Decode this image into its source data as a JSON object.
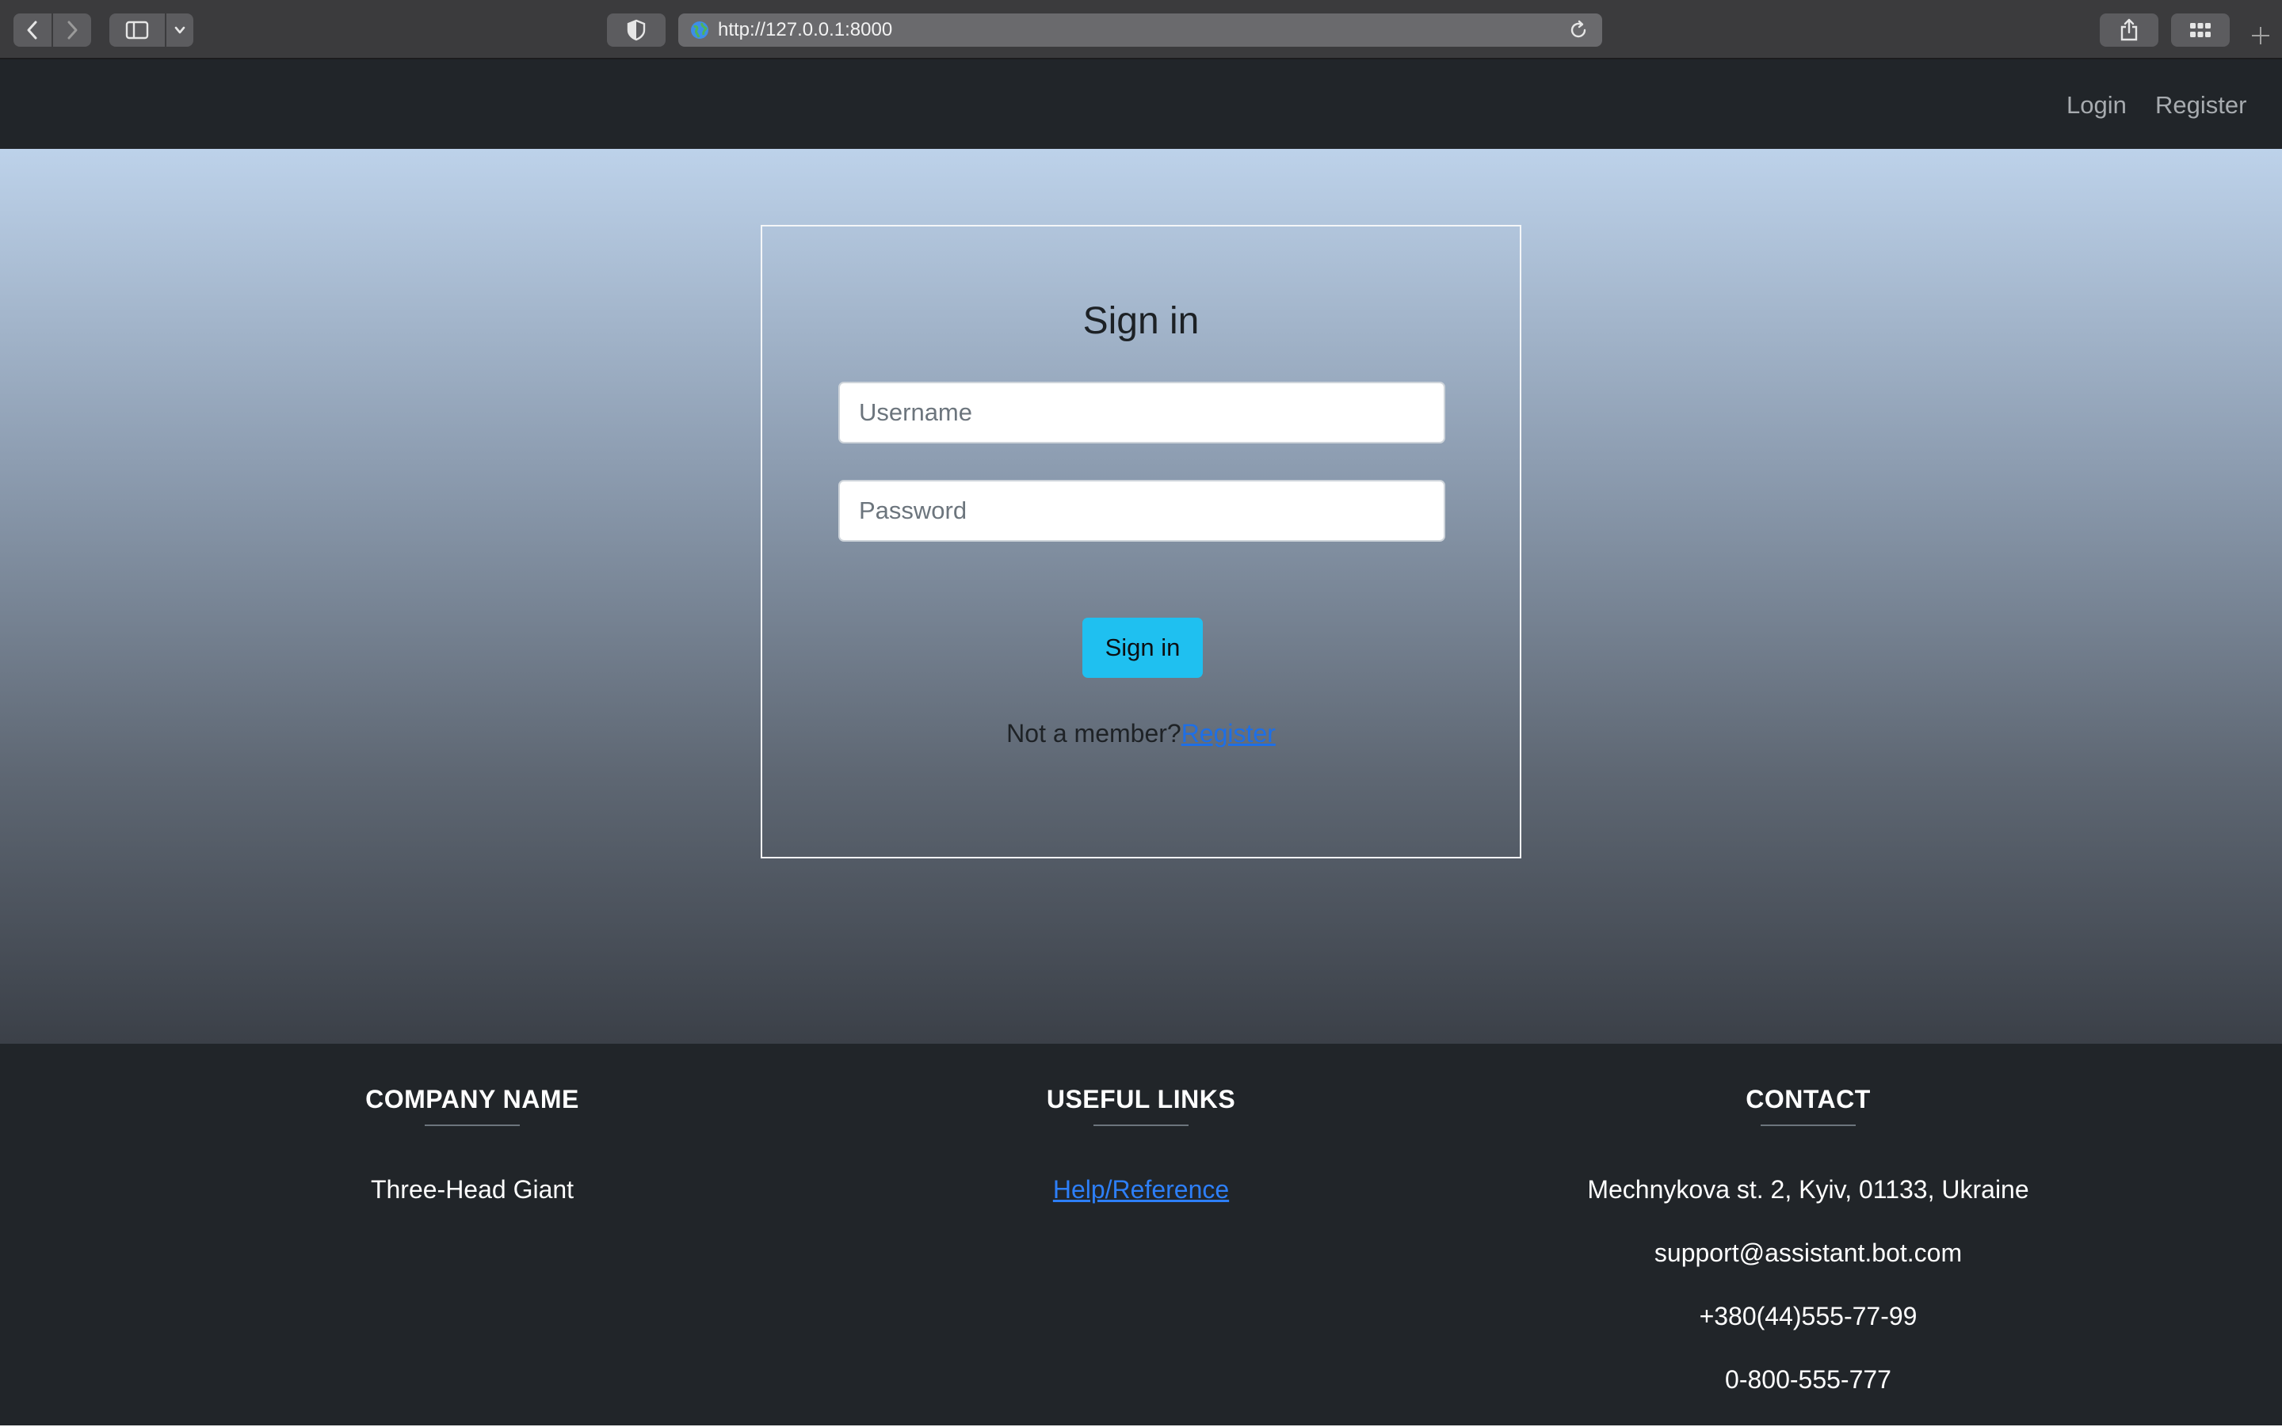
{
  "browser": {
    "url": "http://127.0.0.1:8000"
  },
  "navbar": {
    "login": "Login",
    "register": "Register"
  },
  "signin": {
    "title": "Sign in",
    "username_placeholder": "Username",
    "password_placeholder": "Password",
    "button": "Sign in",
    "member_text": "Not a member?",
    "register_link": "Register"
  },
  "footer": {
    "company": {
      "heading": "COMPANY NAME",
      "name": "Three-Head Giant"
    },
    "links": {
      "heading": "USEFUL LINKS",
      "help": "Help/Reference"
    },
    "contact": {
      "heading": "CONTACT",
      "address": "Mechnykova st. 2, Kyiv, 01133, Ukraine",
      "email": "support@assistant.bot.com",
      "phone": "+380(44)555-77-99",
      "hotline": "0-800-555-777"
    }
  },
  "colors": {
    "navbar_bg": "#212529",
    "button_bg": "#1fc0f0",
    "link": "#1e6fe6"
  }
}
